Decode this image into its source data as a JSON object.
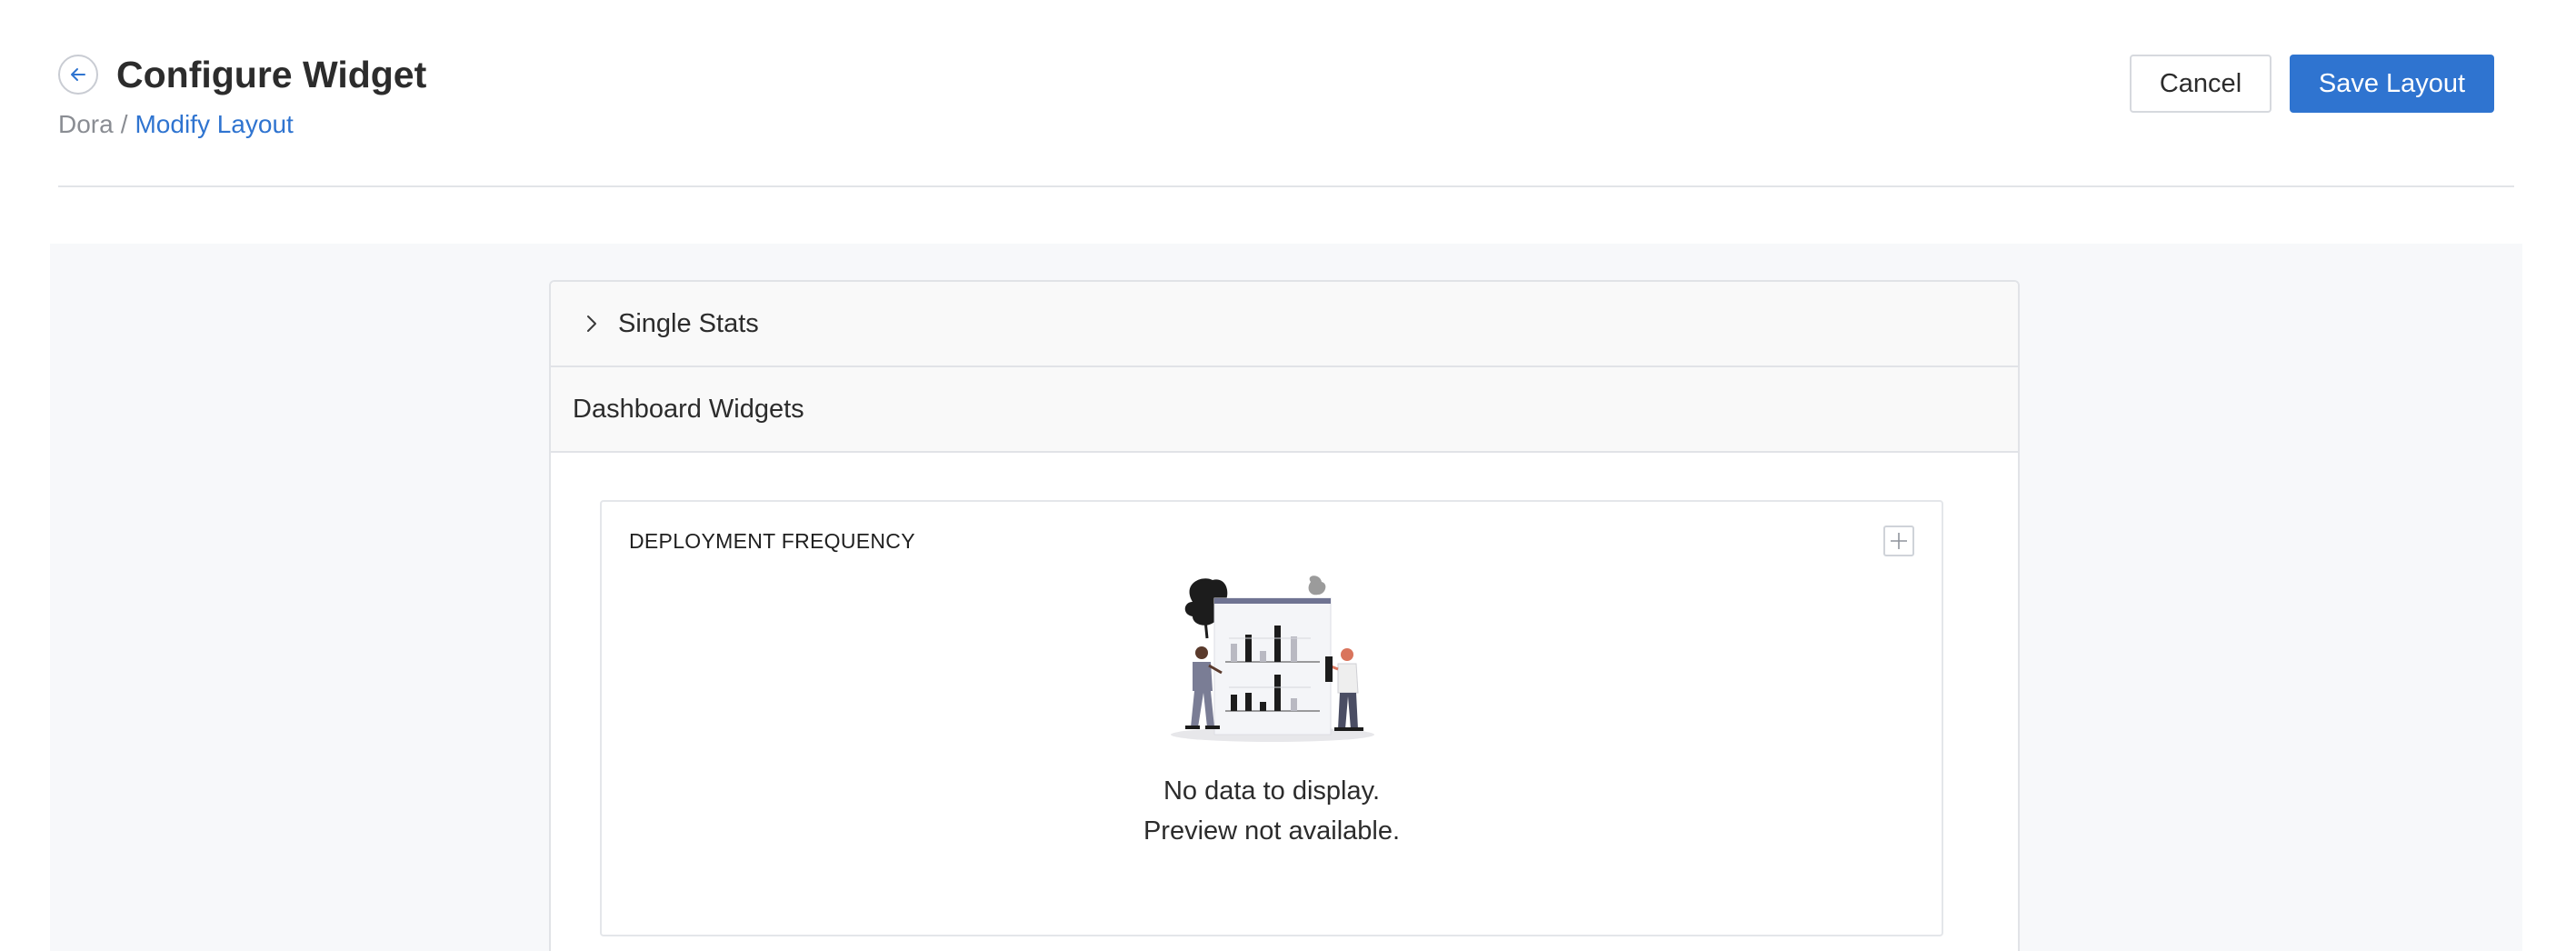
{
  "header": {
    "title": "Configure Widget",
    "breadcrumb": {
      "root": "Dora",
      "separator": "/",
      "current": "Modify Layout"
    },
    "cancel_label": "Cancel",
    "save_label": "Save Layout"
  },
  "sections": {
    "single_stats_label": "Single Stats",
    "dashboard_widgets_label": "Dashboard Widgets"
  },
  "widget": {
    "title": "DEPLOYMENT FREQUENCY",
    "empty_line1": "No data to display.",
    "empty_line2": "Preview not available."
  },
  "icons": {
    "back": "arrow-left-icon",
    "expand": "chevron-right-icon",
    "drag": "move-plus-icon",
    "illustration": "empty-data-illustration"
  },
  "colors": {
    "accent": "#2f74d0",
    "breadcrumb_muted": "#8a8d93",
    "content_bg": "#f7f8fa",
    "border": "#e1e3e7"
  }
}
